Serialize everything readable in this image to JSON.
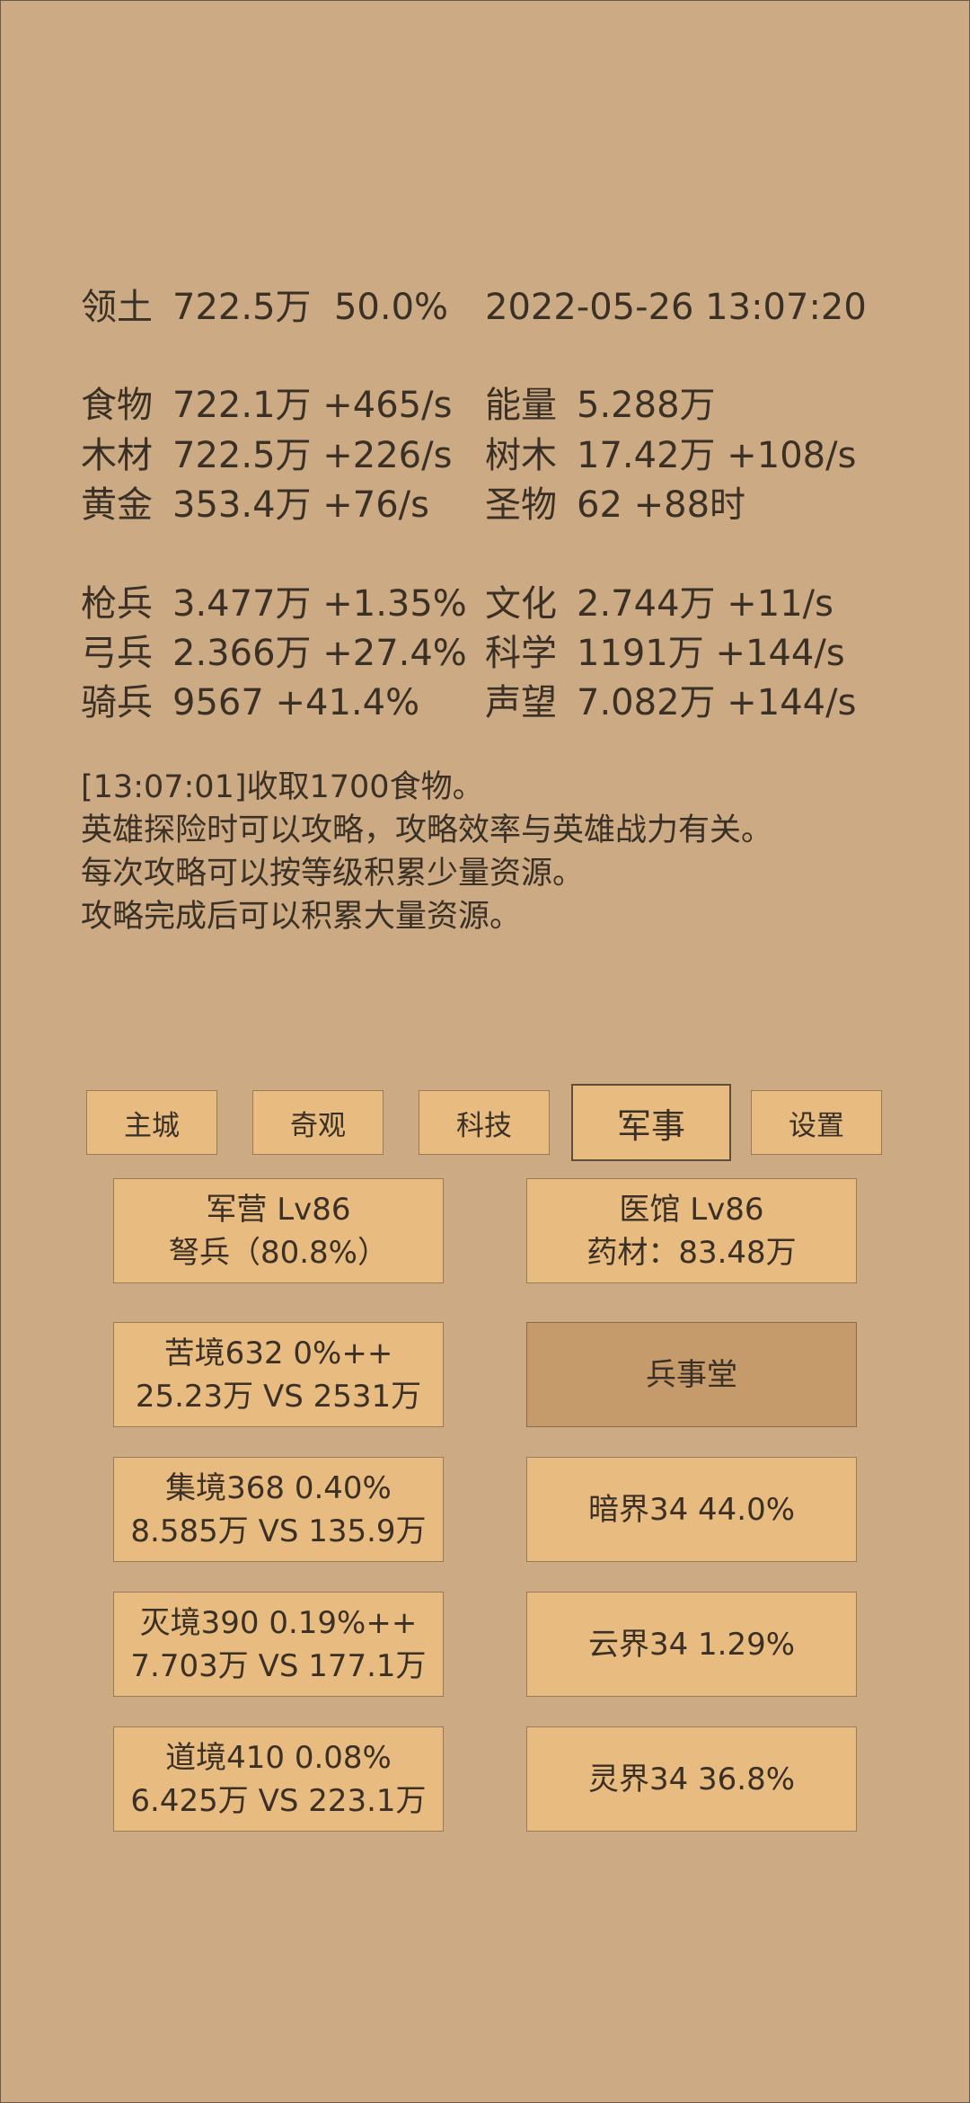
{
  "header": {
    "territory_label": "领土",
    "territory_value": "722.5万",
    "territory_percent": "50.0%",
    "datetime": "2022-05-26 13:07:20"
  },
  "resources": [
    {
      "label": "食物",
      "value": "722.1万 +465/s"
    },
    {
      "label": "木材",
      "value": "722.5万 +226/s"
    },
    {
      "label": "黄金",
      "value": "353.4万 +76/s"
    }
  ],
  "resources_right": [
    {
      "label": "能量",
      "value": "5.288万"
    },
    {
      "label": "树木",
      "value": "17.42万 +108/s"
    },
    {
      "label": "圣物",
      "value": "62 +88时"
    }
  ],
  "troops": [
    {
      "label": "枪兵",
      "value": "3.477万 +1.35%"
    },
    {
      "label": "弓兵",
      "value": "2.366万 +27.4%"
    },
    {
      "label": "骑兵",
      "value": "9567 +41.4%"
    }
  ],
  "culture": [
    {
      "label": "文化",
      "value": "2.744万 +11/s"
    },
    {
      "label": "科学",
      "value": "1191万 +144/s"
    },
    {
      "label": "声望",
      "value": "7.082万 +144/s"
    }
  ],
  "messages": [
    "[13:07:01]收取1700食物。",
    "英雄探险时可以攻略，攻略效率与英雄战力有关。",
    "每次攻略可以按等级积累少量资源。",
    "攻略完成后可以积累大量资源。"
  ],
  "tabs": [
    "主城",
    "奇观",
    "科技",
    "军事",
    "设置"
  ],
  "active_tab": "军事",
  "cards": {
    "barracks": {
      "line1": "军营 Lv86",
      "line2": "弩兵（80.8%）"
    },
    "clinic": {
      "line1": "医馆 Lv86",
      "line2": "药材：83.48万"
    },
    "kujing": {
      "line1": "苦境632  0%++",
      "line2": "25.23万 VS 2531万"
    },
    "bingshitang": {
      "line1": "兵事堂"
    },
    "jijing": {
      "line1": "集境368  0.40%",
      "line2": "8.585万 VS 135.9万"
    },
    "anjie": {
      "line1": "暗界34  44.0%"
    },
    "miejing": {
      "line1": "灭境390  0.19%++",
      "line2": "7.703万 VS 177.1万"
    },
    "yunjie": {
      "line1": "云界34  1.29%"
    },
    "daojing": {
      "line1": "道境410  0.08%",
      "line2": "6.425万 VS 223.1万"
    },
    "lingjie": {
      "line1": "灵界34  36.8%"
    }
  },
  "colors": {
    "background": "#ccab84",
    "button": "#e8bb81",
    "button_dark": "#c69b6b",
    "text": "#3a3026"
  }
}
